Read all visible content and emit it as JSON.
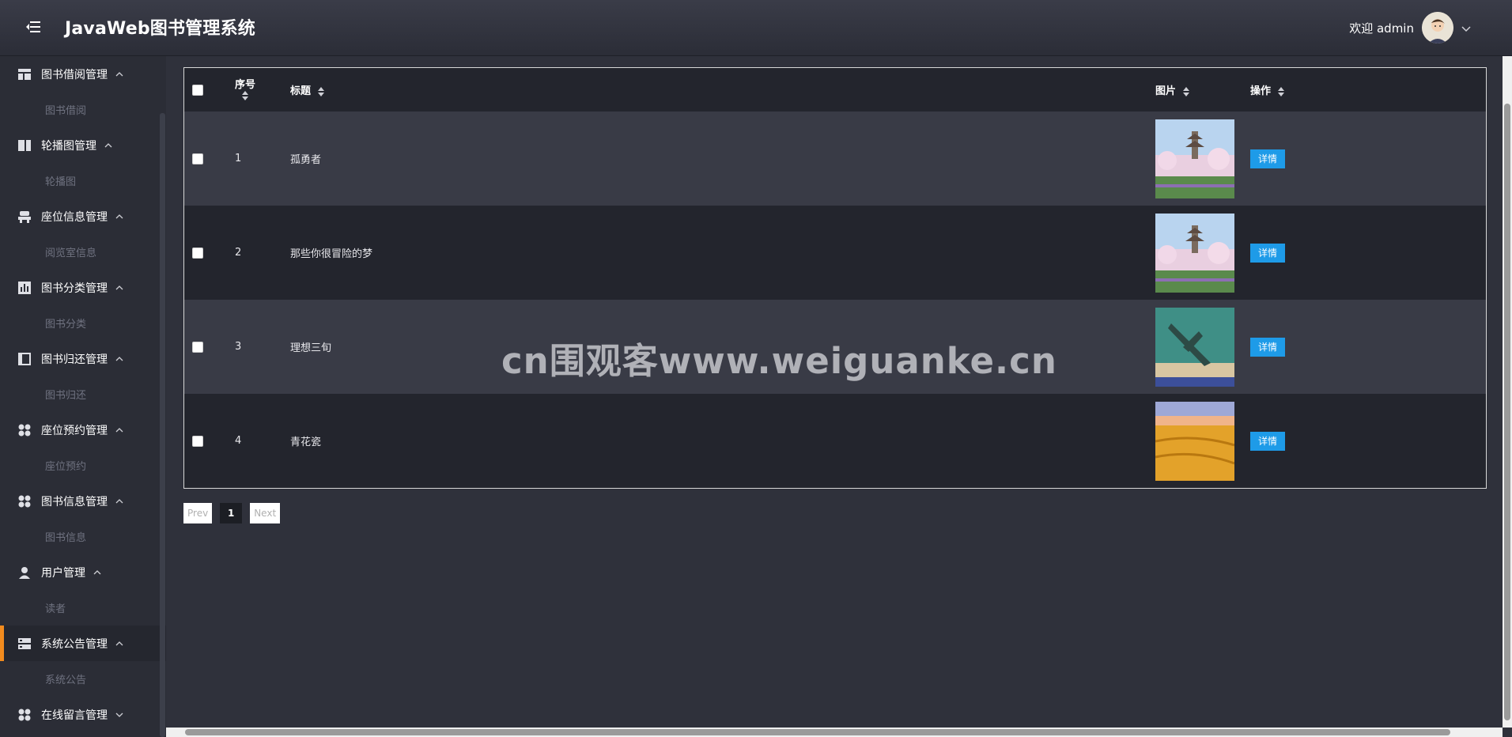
{
  "header": {
    "title": "JavaWeb图书管理系统",
    "welcome": "欢迎 admin",
    "menu_icon": "menu-fold-icon",
    "avatar_icon": "user-avatar",
    "dropdown_icon": "chevron-down-icon"
  },
  "sidebar": {
    "groups": [
      {
        "title": "图书借阅管理",
        "sub": "图书借阅",
        "icon": "layout-icon"
      },
      {
        "title": "轮播图管理",
        "sub": "轮播图",
        "icon": "columns-icon"
      },
      {
        "title": "座位信息管理",
        "sub": "阅览室信息",
        "icon": "seat-icon"
      },
      {
        "title": "图书分类管理",
        "sub": "图书分类",
        "icon": "bar-chart-icon"
      },
      {
        "title": "图书归还管理",
        "sub": "图书归还",
        "icon": "panel-icon"
      },
      {
        "title": "座位预约管理",
        "sub": "座位预约",
        "icon": "apps-icon"
      },
      {
        "title": "图书信息管理",
        "sub": "图书信息",
        "icon": "apps-icon"
      },
      {
        "title": "用户管理",
        "sub": "读者",
        "icon": "user-icon"
      },
      {
        "title": "系统公告管理",
        "sub": "系统公告",
        "icon": "server-icon"
      },
      {
        "title": "在线留言管理",
        "icon": "apps-icon"
      }
    ],
    "active_group": "系统公告管理"
  },
  "table": {
    "columns": {
      "index": "序号",
      "title": "标题",
      "image": "图片",
      "action": "操作"
    },
    "rows": [
      {
        "index": "1",
        "title": "孤勇者",
        "image": "pagoda-blossom",
        "action": "详情"
      },
      {
        "index": "2",
        "title": "那些你很冒险的梦",
        "image": "pagoda-blossom",
        "action": "详情"
      },
      {
        "index": "3",
        "title": "理想三旬",
        "image": "airplane-beach",
        "action": "详情"
      },
      {
        "index": "4",
        "title": "青花瓷",
        "image": "wheat-field-sunset",
        "action": "详情"
      }
    ]
  },
  "pagination": {
    "prev": "Prev",
    "current": "1",
    "next": "Next"
  },
  "watermark": "cn围观客www.weiguanke.cn",
  "colors": {
    "accent": "#1e9be8",
    "active_bar": "#f28b1e",
    "background": "#2f313b"
  }
}
